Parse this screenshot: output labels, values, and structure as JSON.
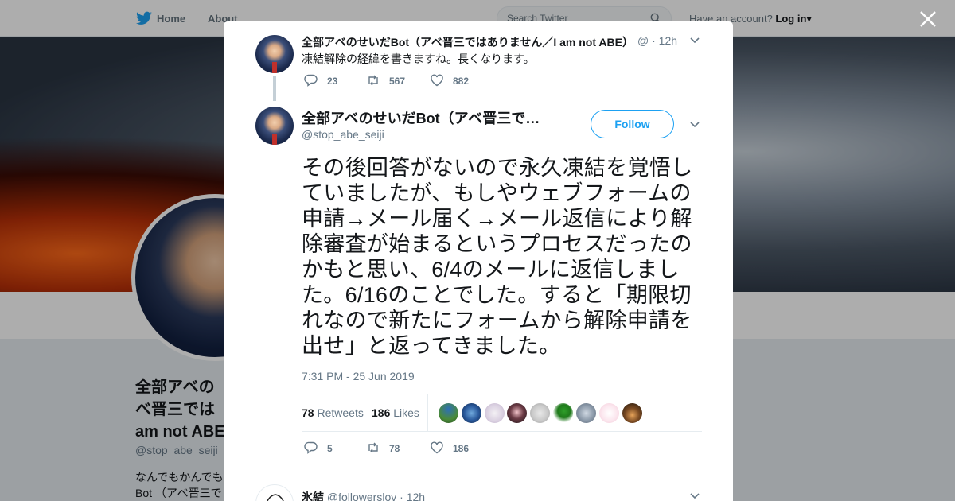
{
  "nav": {
    "home": "Home",
    "about": "About",
    "search_placeholder": "Search Twitter",
    "have_account": "Have an account?",
    "login": "Log in"
  },
  "background_profile": {
    "name": "全部アベのせいだBot（アベ晋三ではありません／I am not ABE）",
    "name_visible": "全部アベの\nべ晋三では\nam not ABE",
    "handle": "@stop_abe_seiji",
    "bio_visible": "なんでもかんでも\nBot （アベ晋三で"
  },
  "prev_tweet": {
    "name": "全部アベのせいだBot（アベ晋三ではありません／I am not ABE）",
    "meta": "@ · 12h",
    "text": "凍結解除の経緯を書きますね。長くなります。",
    "replies": "23",
    "retweets": "567",
    "likes": "882"
  },
  "main_tweet": {
    "name": "全部アベのせいだBot（アベ晋三で…",
    "handle": "@stop_abe_seiji",
    "follow_label": "Follow",
    "text": "その後回答がないので永久凍結を覚悟していましたが、もしやウェブフォームの申請→メール届く→メール返信により解除審査が始まるというプロセスだったのかもと思い、6/4のメールに返信しました。6/16のことでした。すると「期限切れなので新たにフォームから解除申請を出せ」と返ってきました。",
    "timestamp": "7:31 PM - 25 Jun 2019",
    "retweets_count": "78",
    "retweets_label": "Retweets",
    "likes_count": "186",
    "likes_label": "Likes",
    "replies": "5",
    "retweets": "78",
    "likes": "186"
  },
  "reply_tweet": {
    "name": "氷結",
    "handle": "@followerslov",
    "time": "· 12h"
  },
  "colors": {
    "accent": "#1da1f2",
    "text": "#14171a",
    "muted": "#657786"
  }
}
